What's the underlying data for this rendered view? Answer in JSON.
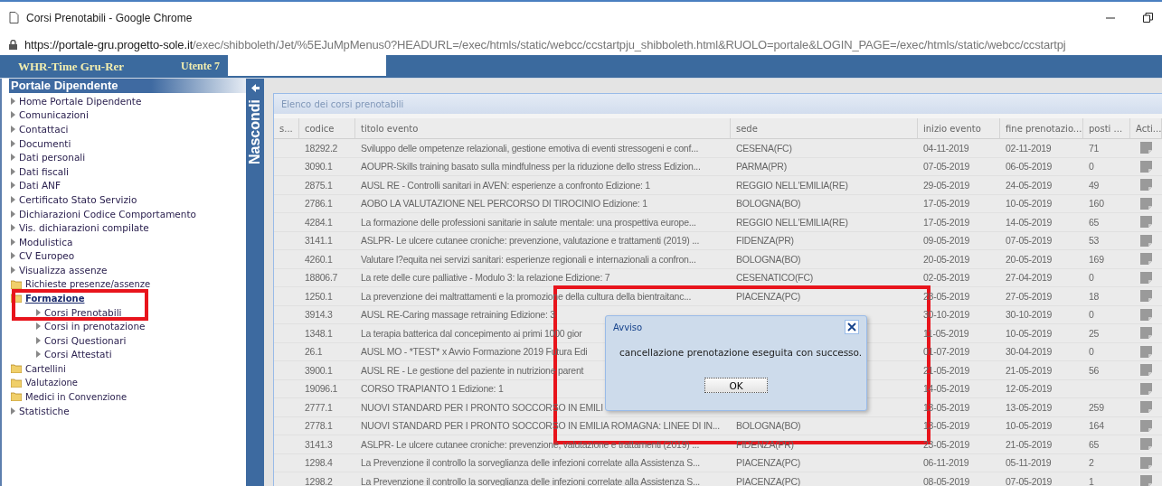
{
  "browser": {
    "title": "Corsi Prenotabili - Google Chrome",
    "url_domain": "https://portale-gru.progetto-sole.it",
    "url_path": "/exec/shibboleth/Jet/%5EJuMpMenus0?HEADURL=/exec/htmls/static/webcc/ccstartpju_shibboleth.html&RUOLO=portale&LOGIN_PAGE=/exec/htmls/static/webcc/ccstartpj"
  },
  "app_bar": {
    "brand": "WHR-Time Gru-Rer",
    "user_label": "Utente 7"
  },
  "sidebar": {
    "title": "Portale Dipendente",
    "toggle_label": "Nascondi",
    "items": [
      {
        "label": "Home Portale Dipendente",
        "kind": "link",
        "selected": false
      },
      {
        "label": "Comunicazioni",
        "kind": "link",
        "selected": false
      },
      {
        "label": "Contattaci",
        "kind": "link",
        "selected": false
      },
      {
        "label": "Documenti",
        "kind": "link",
        "selected": false
      },
      {
        "label": "Dati personali",
        "kind": "link",
        "selected": false
      },
      {
        "label": "Dati fiscali",
        "kind": "link",
        "selected": false
      },
      {
        "label": "Dati ANF",
        "kind": "link",
        "selected": false
      },
      {
        "label": "Certificato Stato Servizio",
        "kind": "link",
        "selected": false
      },
      {
        "label": "Dichiarazioni Codice Comportamento",
        "kind": "link",
        "selected": false
      },
      {
        "label": "Vis. dichiarazioni compilate",
        "kind": "link",
        "selected": false
      },
      {
        "label": "Modulistica",
        "kind": "link",
        "selected": false
      },
      {
        "label": "CV Europeo",
        "kind": "link",
        "selected": false
      },
      {
        "label": "Visualizza assenze",
        "kind": "link",
        "selected": false
      },
      {
        "label": "Richieste presenze/assenze",
        "kind": "folder",
        "selected": false
      },
      {
        "label": "Formazione",
        "kind": "folder",
        "selected": true,
        "children": [
          {
            "label": "Corsi Prenotabili",
            "kind": "link",
            "selected": false
          },
          {
            "label": "Corsi in prenotazione",
            "kind": "link",
            "selected": false
          },
          {
            "label": "Corsi Questionari",
            "kind": "link",
            "selected": false
          },
          {
            "label": "Corsi Attestati",
            "kind": "link",
            "selected": false
          }
        ]
      },
      {
        "label": "Cartellini",
        "kind": "folder",
        "selected": false
      },
      {
        "label": "Valutazione",
        "kind": "folder",
        "selected": false
      },
      {
        "label": "Medici in Convenzione",
        "kind": "folder",
        "selected": false
      },
      {
        "label": "Statistiche",
        "kind": "link",
        "selected": false
      }
    ]
  },
  "panel": {
    "title": "Elenco dei corsi prenotabili",
    "columns": [
      "s...",
      "codice",
      "titolo evento",
      "sede",
      "inizio evento",
      "fine prenotazio...",
      "posti ...",
      "Acti..."
    ],
    "rows": [
      {
        "codice": "18292.2",
        "titolo": "Sviluppo delle ompetenze relazionali, gestione emotiva di eventi stressogeni e conf...",
        "sede": "CESENA(FC)",
        "inizio": "04-11-2019",
        "fine": "02-11-2019",
        "posti": "71"
      },
      {
        "codice": "3090.1",
        "titolo": "AOUPR-Skills training basato sulla mindfulness per la riduzione dello stress Edizion...",
        "sede": "PARMA(PR)",
        "inizio": "07-05-2019",
        "fine": "06-05-2019",
        "posti": "0"
      },
      {
        "codice": "2875.1",
        "titolo": "AUSL RE - Controlli sanitari in AVEN: esperienze a confronto Edizione: 1",
        "sede": "REGGIO NELL'EMILIA(RE)",
        "inizio": "29-05-2019",
        "fine": "24-05-2019",
        "posti": "49"
      },
      {
        "codice": "2786.1",
        "titolo": "AOBO LA VALUTAZIONE NEL PERCORSO DI TIROCINIO Edizione: 1",
        "sede": "BOLOGNA(BO)",
        "inizio": "17-05-2019",
        "fine": "10-05-2019",
        "posti": "160"
      },
      {
        "codice": "4284.1",
        "titolo": "La formazione delle professioni sanitarie in salute mentale: una prospettiva europe...",
        "sede": "REGGIO NELL'EMILIA(RE)",
        "inizio": "17-05-2019",
        "fine": "14-05-2019",
        "posti": "65"
      },
      {
        "codice": "3141.1",
        "titolo": "ASLPR- Le ulcere cutanee croniche: prevenzione, valutazione e trattamenti (2019) ...",
        "sede": "FIDENZA(PR)",
        "inizio": "09-05-2019",
        "fine": "07-05-2019",
        "posti": "53"
      },
      {
        "codice": "4260.1",
        "titolo": "Valutare l?equita nei servizi sanitari: esperienze regionali e internazionali a confron...",
        "sede": "BOLOGNA(BO)",
        "inizio": "20-05-2019",
        "fine": "20-05-2019",
        "posti": "169"
      },
      {
        "codice": "18806.7",
        "titolo": "La rete delle cure palliative - Modulo 3: la relazione Edizione: 7",
        "sede": "CESENATICO(FC)",
        "inizio": "02-05-2019",
        "fine": "27-04-2019",
        "posti": "0"
      },
      {
        "codice": "1250.1",
        "titolo": "La prevenzione dei maltrattamenti e la promozione della cultura della bientraitanc...",
        "sede": "PIACENZA(PC)",
        "inizio": "28-05-2019",
        "fine": "27-05-2019",
        "posti": "18"
      },
      {
        "codice": "3914.3",
        "titolo": "AUSL RE-Caring massage retraining Edizione: 3",
        "inizio": "30-10-2019",
        "fine": "30-10-2019",
        "posti": "0"
      },
      {
        "codice": "1348.1",
        "titolo": "La terapia batterica dal concepimento ai primi 1000 gior",
        "inizio": "11-05-2019",
        "fine": "10-05-2019",
        "posti": "25"
      },
      {
        "codice": "26.1",
        "titolo": "AUSL MO - *TEST* x Avvio Formazione 2019 Futura Edi",
        "inizio": "01-07-2019",
        "fine": "30-04-2019",
        "posti": "0"
      },
      {
        "codice": "3900.1",
        "titolo": "AUSL RE - Le gestione del paziente in nutrizione parent",
        "inizio": "21-05-2019",
        "fine": "21-05-2019",
        "posti": "56"
      },
      {
        "codice": "19096.1",
        "titolo": "CORSO TRAPIANTO 1 Edizione: 1",
        "inizio": "14-05-2019",
        "fine": "12-05-2019"
      },
      {
        "codice": "2777.1",
        "titolo": "NUOVI STANDARD PER I PRONTO SOCCORSO IN EMILI",
        "inizio": "13-05-2019",
        "fine": "13-05-2019",
        "posti": "259"
      },
      {
        "codice": "2778.1",
        "titolo": "NUOVI STANDARD PER I PRONTO SOCCORSO IN EMILIA ROMAGNA: LINEE DI IN...",
        "sede": "BOLOGNA(BO)",
        "inizio": "13-05-2019",
        "fine": "10-05-2019",
        "posti": "164"
      },
      {
        "codice": "3141.3",
        "titolo": "ASLPR- Le ulcere cutanee croniche: prevenzione, valutazione e trattamenti (2019) ...",
        "sede": "FIDENZA(PR)",
        "inizio": "23-05-2019",
        "fine": "21-05-2019",
        "posti": "65"
      },
      {
        "codice": "1298.4",
        "titolo": "La Prevenzione il controllo la sorveglianza delle infezioni correlate alla Assistenza S...",
        "sede": "PIACENZA(PC)",
        "inizio": "06-11-2019",
        "fine": "05-11-2019",
        "posti": "2"
      },
      {
        "codice": "1298.2",
        "titolo": "La Prevenzione il controllo la sorveglianza delle infezioni correlate alla Assistenza S...",
        "sede": "PIACENZA(PC)",
        "inizio": "08-05-2019",
        "fine": "07-05-2019",
        "posti": "1"
      }
    ]
  },
  "dialog": {
    "title": "Avviso",
    "message": "cancellazione prenotazione eseguita con successo.",
    "button": "OK"
  }
}
